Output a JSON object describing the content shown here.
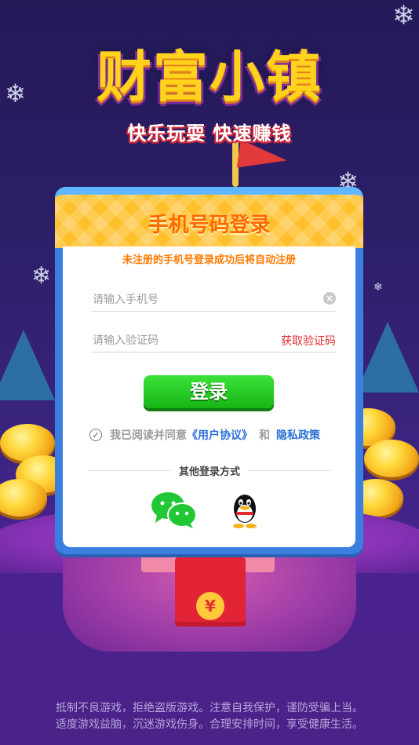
{
  "header": {
    "title": "财富小镇",
    "subtitle": "快乐玩耍 快速赚钱"
  },
  "login_card": {
    "title": "手机号码登录",
    "notice": "未注册的手机号登录成功后将自动注册",
    "phone_placeholder": "请输入手机号",
    "code_placeholder": "请输入验证码",
    "get_code_label": "获取验证码",
    "login_button": "登录",
    "agreement": {
      "prefix": "我已阅读并同意",
      "user_agreement": "《用户协议》",
      "and": "和",
      "privacy_policy": "隐私政策"
    },
    "other_login_label": "其他登录方式",
    "other_login_methods": [
      "wechat-icon",
      "qq-icon"
    ]
  },
  "footer": {
    "line1": "抵制不良游戏，拒绝盗版游戏。注意自我保护，谨防受骗上当。",
    "line2": "适度游戏益脑，沉迷游戏伤身。合理安排时间，享受健康生活。"
  },
  "colors": {
    "accent_orange": "#ff6a00",
    "login_green": "#16b515",
    "link_blue": "#2b6fd6",
    "card_blue": "#3b7fe0"
  }
}
